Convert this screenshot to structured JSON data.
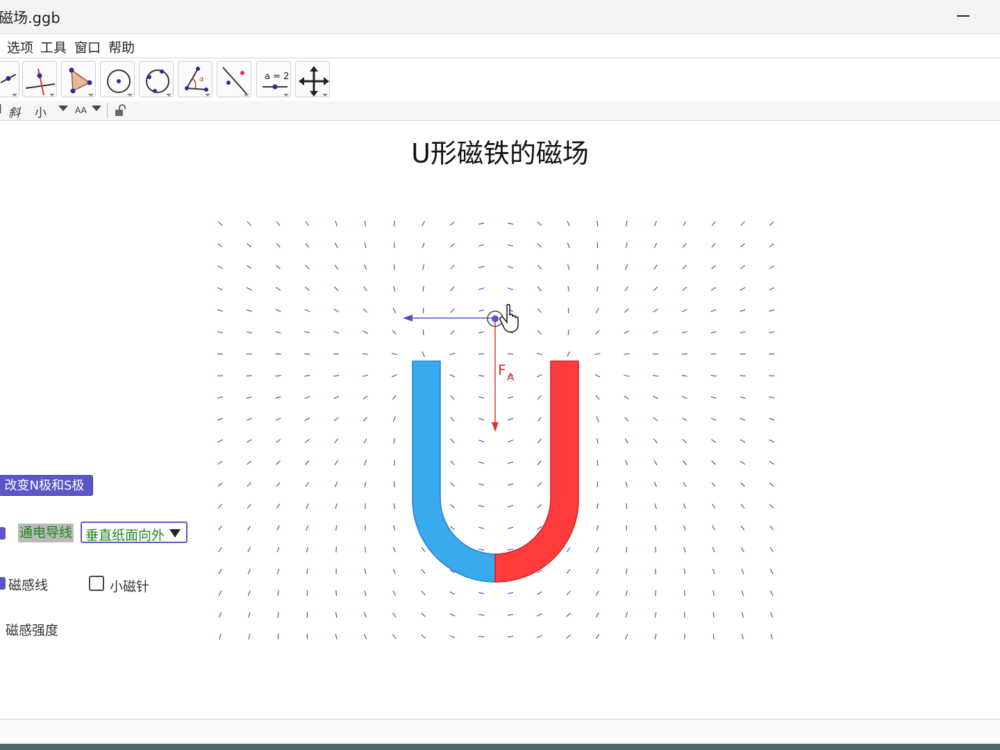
{
  "window": {
    "title": "磁场.ggb"
  },
  "menu": {
    "items": [
      "选项",
      "工具",
      "窗口",
      "帮助"
    ]
  },
  "toolbar": {
    "tools": [
      "move-point-icon",
      "perpendicular-line-icon",
      "polygon-icon",
      "circle-center-icon",
      "circle-three-points-icon",
      "angle-icon",
      "reflect-line-icon",
      "slider-icon",
      "move-view-icon"
    ],
    "slider_label": "a = 2"
  },
  "stylebar": {
    "italic": "斜",
    "size": "小",
    "font_size_icon": "AA"
  },
  "page": {
    "title": "U形磁铁的磁场"
  },
  "controls": {
    "swap_button": "改变N极和S极",
    "wire_label": "通电导线",
    "wire_direction": "垂直纸面向外",
    "field_lines_label": "磁感线",
    "compass_label": "小磁针",
    "field_strength_label": "磁感强度"
  },
  "diagram": {
    "force_label": "F",
    "force_subscript": "A",
    "colors": {
      "north": "#ff3b3b",
      "south": "#3aaaf0",
      "field": "#4a4ad8",
      "force": "#e03030",
      "velocity": "#5252c8"
    }
  }
}
